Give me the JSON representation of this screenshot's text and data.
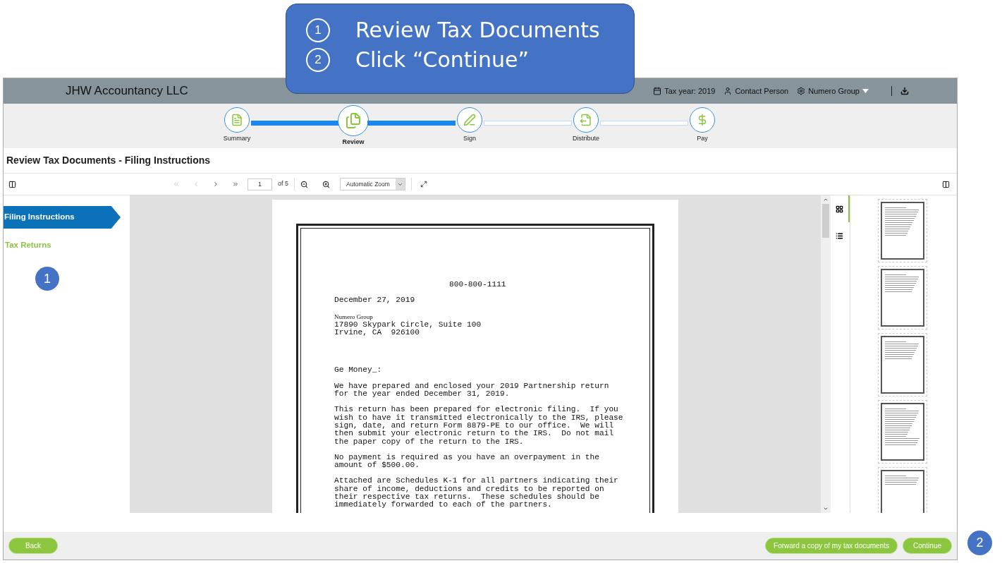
{
  "callout": {
    "items": [
      {
        "number": "1",
        "text": "Review Tax Documents"
      },
      {
        "number": "2",
        "text": "Click “Continue”"
      }
    ]
  },
  "header": {
    "brand": "JHW Accountancy LLC",
    "tax_year": "Tax year: 2019",
    "contact": "Contact Person",
    "group": "Numero Group"
  },
  "steps": [
    {
      "label": "Summary",
      "kind": "summary",
      "selected": false
    },
    {
      "label": "Review",
      "kind": "review",
      "reached": true,
      "selected": true
    },
    {
      "label": "Sign",
      "kind": "sign",
      "reached": true,
      "selected": false
    },
    {
      "label": "Distribute",
      "kind": "distribute",
      "reached": false,
      "selected": false
    },
    {
      "label": "Pay",
      "kind": "pay",
      "reached": false,
      "selected": false
    }
  ],
  "page_title": "Review Tax Documents - Filing Instructions",
  "toolbar": {
    "nav": [
      {
        "kind": "first",
        "disabled": true
      },
      {
        "kind": "prev",
        "disabled": true
      },
      {
        "kind": "next",
        "disabled": false
      },
      {
        "kind": "last",
        "disabled": false
      }
    ],
    "page": "1",
    "page_count": "of 5",
    "zoom": "Automatic Zoom"
  },
  "sidebar": {
    "items": [
      {
        "label": "Filing Instructions",
        "selected": true
      },
      {
        "label": "Tax Returns",
        "selected": false
      }
    ],
    "badge": "1"
  },
  "document": {
    "blocks": [
      {
        "kind": "center",
        "lines": [
          "800-800-1111"
        ]
      },
      {
        "kind": "text",
        "lines": [
          "December 27, 2019"
        ]
      },
      {
        "kind": "serif",
        "lines": [
          "Numero Group"
        ]
      },
      {
        "kind": "tight",
        "lines": [
          "17890 Skypark Circle, Suite 100",
          "Irvine, CA  926100"
        ]
      },
      {
        "kind": "gap",
        "lines": [
          "Ge Money_:"
        ]
      },
      {
        "kind": "text",
        "lines": [
          "We have prepared and enclosed your 2019 Partnership return",
          "for the year ended December 31, 2019."
        ]
      },
      {
        "kind": "text",
        "lines": [
          "This return has been prepared for electronic filing.  If you",
          "wish to have it transmitted electronically to the IRS, please",
          "sign, date, and return Form 8879-PE to our office.  We will",
          "then submit your electronic return to the IRS.  Do not mail",
          "the paper copy of the return to the IRS."
        ]
      },
      {
        "kind": "text",
        "lines": [
          "No payment is required as you have an overpayment in the",
          "amount of $500.00."
        ]
      },
      {
        "kind": "text",
        "lines": [
          "Attached are Schedules K-1 for all partners indicating their",
          "share of income, deductions and credits to be reported on",
          "their respective tax returns.  These schedules should be",
          "immediately forwarded to each of the partners."
        ]
      }
    ]
  },
  "view_tabs": [
    {
      "kind": "thumbnails",
      "selected": true
    },
    {
      "kind": "outline",
      "selected": false
    }
  ],
  "footer": {
    "back": "Back",
    "forward": "Forward a copy of my tax documents",
    "continue": "Continue",
    "badge": "2"
  }
}
